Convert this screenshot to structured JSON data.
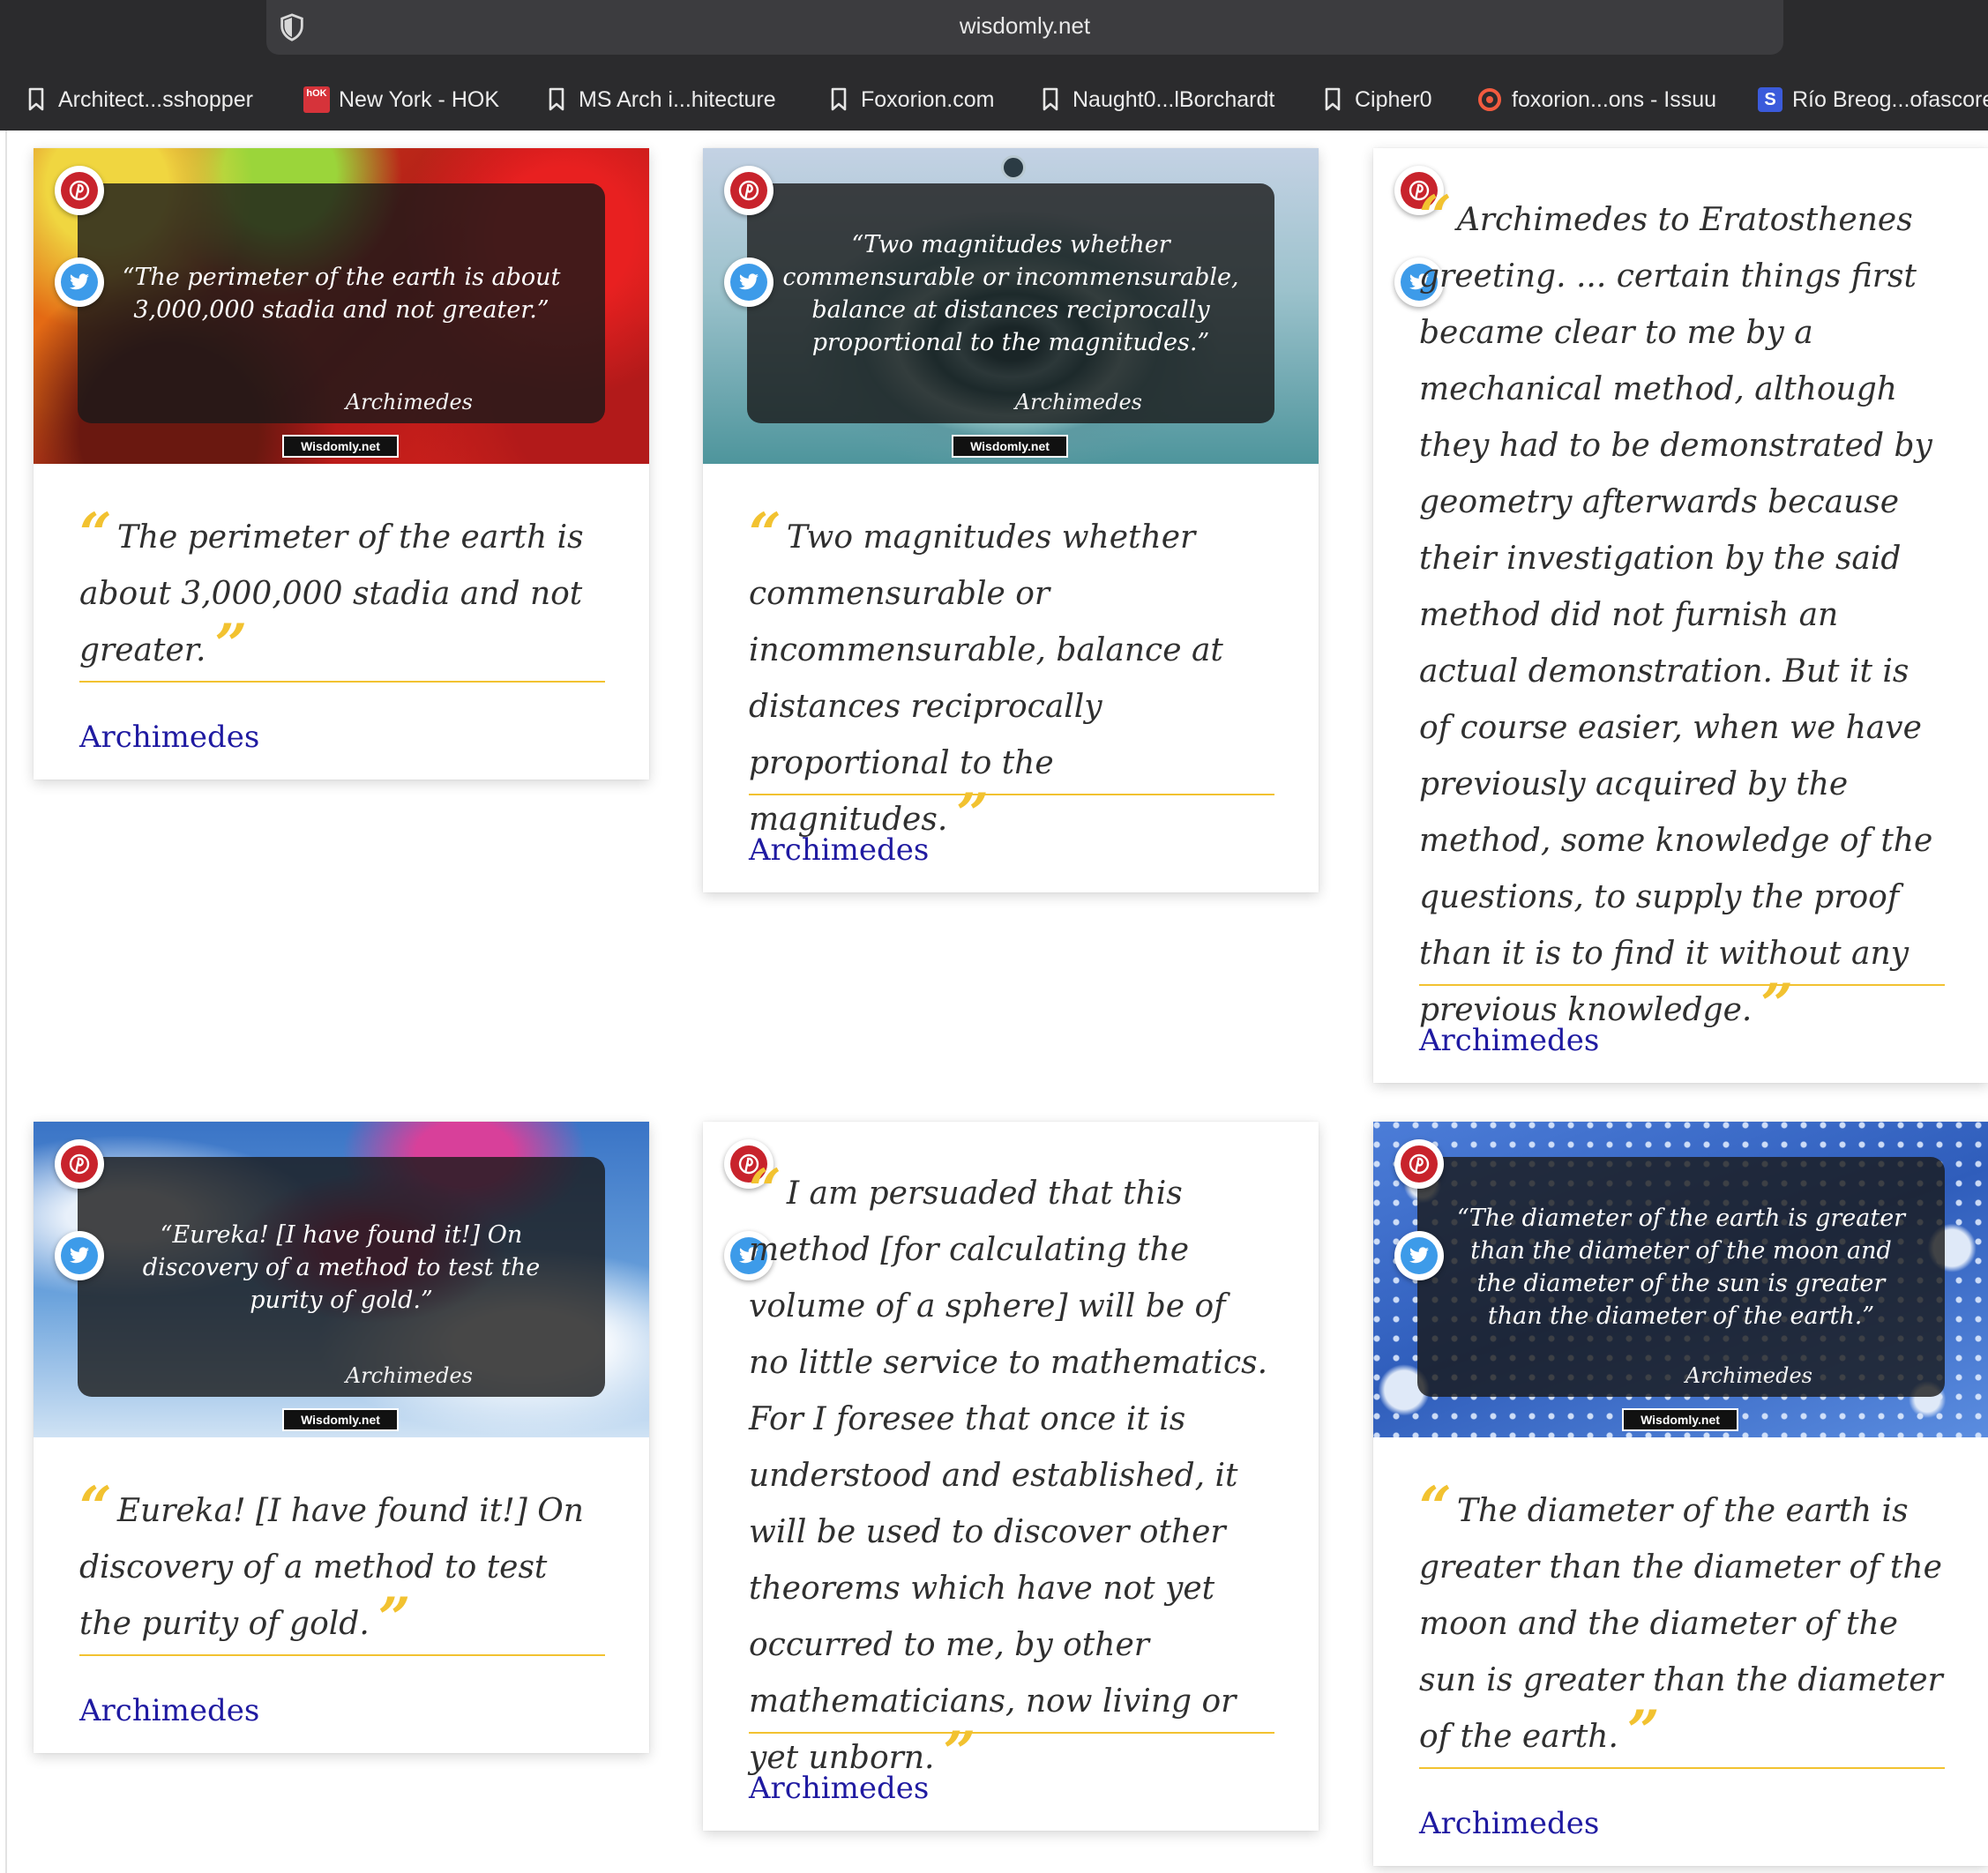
{
  "browser": {
    "url": "wisdomly.net",
    "bookmarks": [
      {
        "label": "Architect...sshopper",
        "icon": "bookmark-icon"
      },
      {
        "label": "New York - HOK",
        "icon": "hok-favicon",
        "icon_text": "hOK"
      },
      {
        "label": "MS Arch i...hitecture",
        "icon": "bookmark-icon"
      },
      {
        "label": "Foxorion.com",
        "icon": "bookmark-icon"
      },
      {
        "label": "Naught0...lBorchardt",
        "icon": "bookmark-icon"
      },
      {
        "label": "Cipher0",
        "icon": "bookmark-icon"
      },
      {
        "label": "foxorion...ons - Issuu",
        "icon": "issuu-favicon"
      },
      {
        "label": "Río Breog...ofascore",
        "icon": "sofascore-favicon",
        "icon_text": "S"
      }
    ]
  },
  "brand_tag": "Wisdomly.net",
  "colors": {
    "accent": "#f2c230",
    "author_link": "#1f1aa1",
    "pinterest": "#c8232c",
    "twitter": "#3d9be9"
  },
  "cards": [
    {
      "image_quote": "“The perimeter of the earth is about 3,000,000 stadia and not greater.”",
      "image_author": "Archimedes",
      "quote": "The perimeter of the earth is about 3,000,000 stadia and not greater.",
      "author": "Archimedes"
    },
    {
      "image_quote": "“Two magnitudes whether commensurable or incommensurable, balance at distances reciprocally proportional to the magnitudes.”",
      "image_author": "Archimedes",
      "quote": "Two magnitudes whether commensurable or incommensurable, balance at distances reciprocally proportional to the magnitudes.",
      "author": "Archimedes"
    },
    {
      "quote": "Archimedes to Eratosthenes greeting. ... certain things first became clear to me by a mechanical method, although they had to be demonstrated by geometry afterwards because their investigation by the said method did not furnish an actual demonstration. But it is of course easier, when we have previously acquired by the method, some knowledge of the questions, to supply the proof than it is to find it without any previous knowledge.",
      "author": "Archimedes"
    },
    {
      "image_quote": "“Eureka! [I have found it!] On discovery of a method to test the purity of gold.”",
      "image_author": "Archimedes",
      "quote": "Eureka! [I have found it!] On discovery of a method to test the purity of gold.",
      "author": "Archimedes"
    },
    {
      "quote": "I am persuaded that this method [for calculating the volume of a sphere] will be of no little service to mathematics. For I foresee that once it is understood and established, it will be used to discover other theorems which have not yet occurred to me, by other mathematicians, now living or yet unborn.",
      "author": "Archimedes"
    },
    {
      "image_quote": "“The diameter of the earth is greater than the diameter of the moon and the diameter of the sun is greater than the diameter of the earth.”",
      "image_author": "Archimedes",
      "quote": "The diameter of the earth is greater than the diameter of the moon and the diameter of the sun is greater than the diameter of the earth.",
      "author": "Archimedes"
    }
  ]
}
